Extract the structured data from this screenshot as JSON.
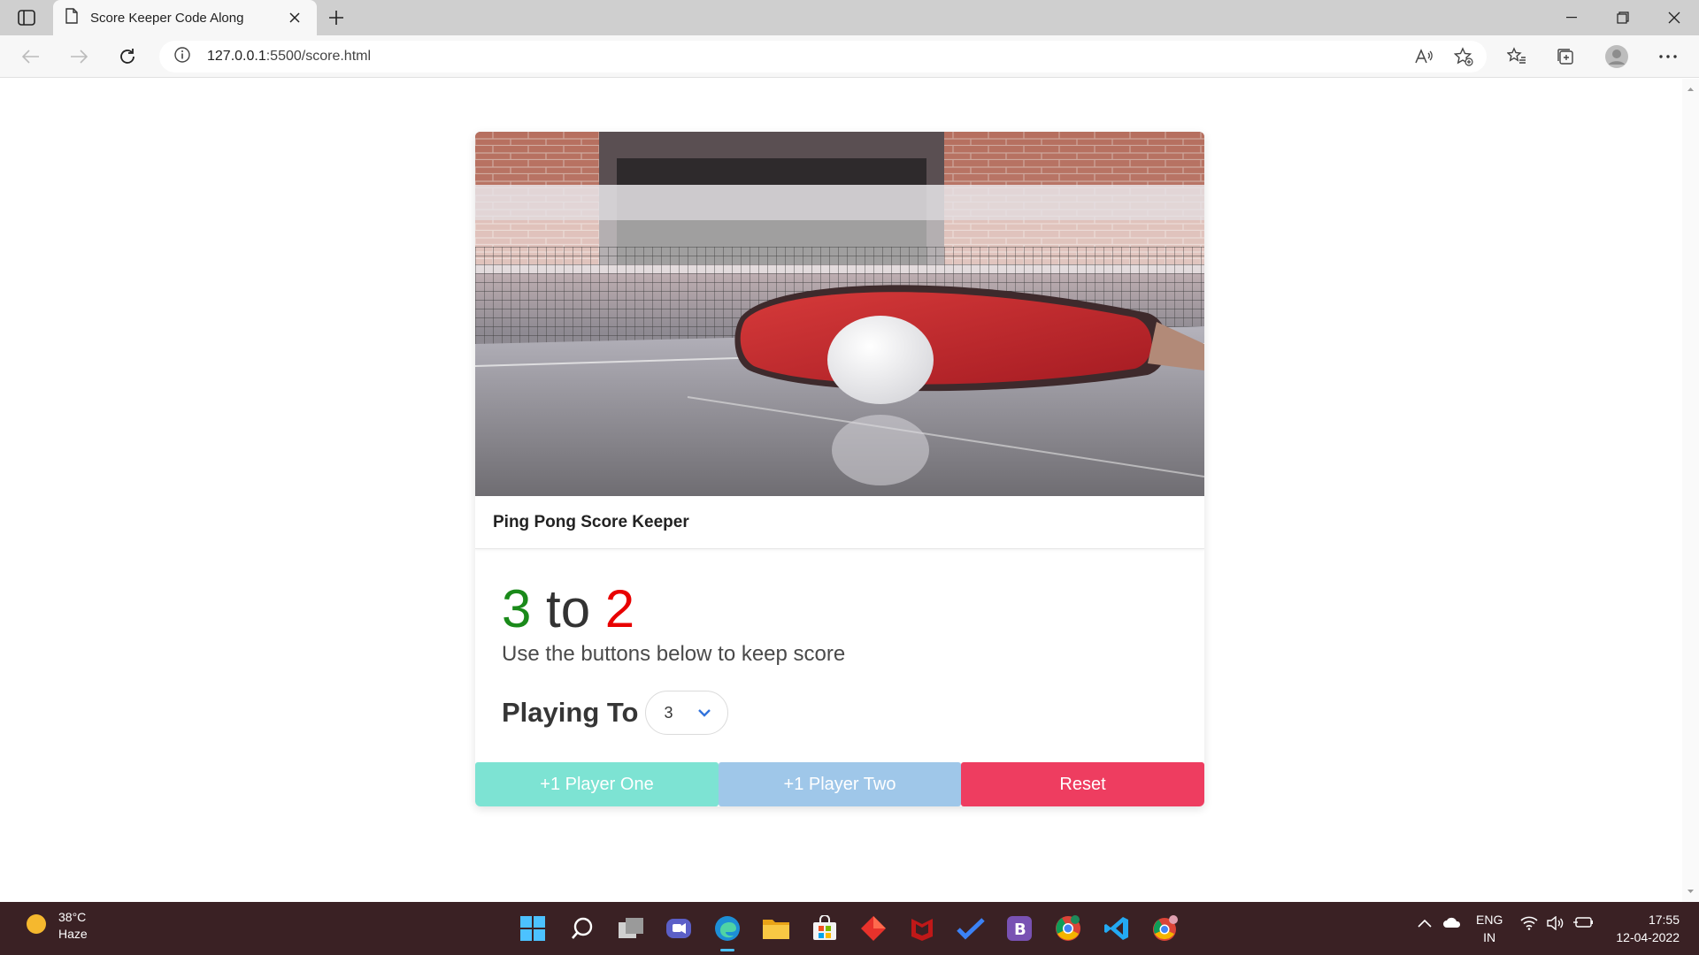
{
  "browser": {
    "tab_title": "Score Keeper Code Along",
    "url_host": "127.0.0.1",
    "url_rest": ":5500/score.html"
  },
  "card": {
    "header_title": "Ping Pong Score Keeper",
    "score_p1": "3",
    "score_sep": "to",
    "score_p2": "2",
    "subtitle": "Use the buttons below to keep score",
    "playing_to_label": "Playing To",
    "playing_to_value": "3",
    "buttons": {
      "p1": "+1 Player One",
      "p2": "+1 Player Two",
      "reset": "Reset"
    }
  },
  "colors": {
    "p1_score": "#1a8a1a",
    "p2_score": "#e80000",
    "btn_p1": "#7de3d3",
    "btn_p2": "#9fc7e9",
    "btn_reset": "#ee3d60"
  },
  "taskbar": {
    "temperature": "38°C",
    "weather": "Haze",
    "lang_top": "ENG",
    "lang_bottom": "IN",
    "time": "17:55",
    "date": "12-04-2022"
  }
}
